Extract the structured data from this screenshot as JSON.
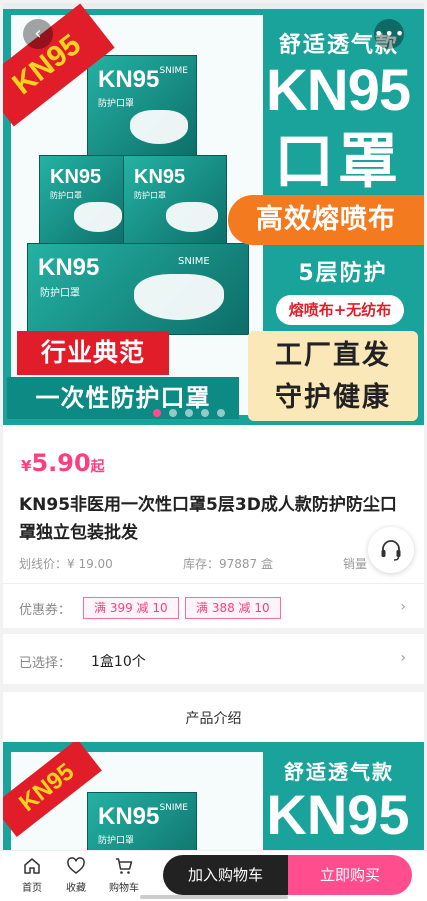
{
  "hero": {
    "tag": "KN95",
    "brand_line": "舒适透气款",
    "big_title": "KN95",
    "big_sub": "口罩",
    "band": "高效熔喷布",
    "layers": "5层防护",
    "pill": "熔喷布+无纺布",
    "red_banner": "行业典范",
    "teal_banner": "一次性防护口罩",
    "factory_line1": "工厂直发",
    "factory_line2": "守护健康",
    "box_label": "KN95",
    "box_sub": "防护口罩",
    "box_brand": "SNIME",
    "back_icon": "chevron-left-icon",
    "more_icon": "more-dots-icon",
    "slide_count": 5,
    "active_slide": 0
  },
  "product": {
    "currency": "¥",
    "price": "5.90",
    "price_suffix": "起",
    "title": "KN95非医用一次性口罩5层3D成人款防护防尘口罩独立包装批发",
    "list_price": "划线价：¥ 19.00",
    "stock": "库存：97887 盒",
    "sales": "销量"
  },
  "coupons": {
    "label": "优惠券：",
    "items": [
      "满 399 减 10",
      "满 388 减 10"
    ]
  },
  "selection": {
    "label": "已选择：",
    "value": "1盒10个"
  },
  "intro": {
    "title": "产品介绍"
  },
  "detail": {
    "tag": "KN95",
    "brand_line": "舒适透气款",
    "big_title": "KN95"
  },
  "bottom_bar": {
    "home": "首页",
    "favorite": "收藏",
    "cart": "购物车",
    "add_to_cart": "加入购物车",
    "buy_now": "立即购买"
  },
  "colors": {
    "accent": "#ff4d8d",
    "price": "#ff3e7f",
    "teal": "#1aa39a",
    "dark_button": "#222222"
  }
}
